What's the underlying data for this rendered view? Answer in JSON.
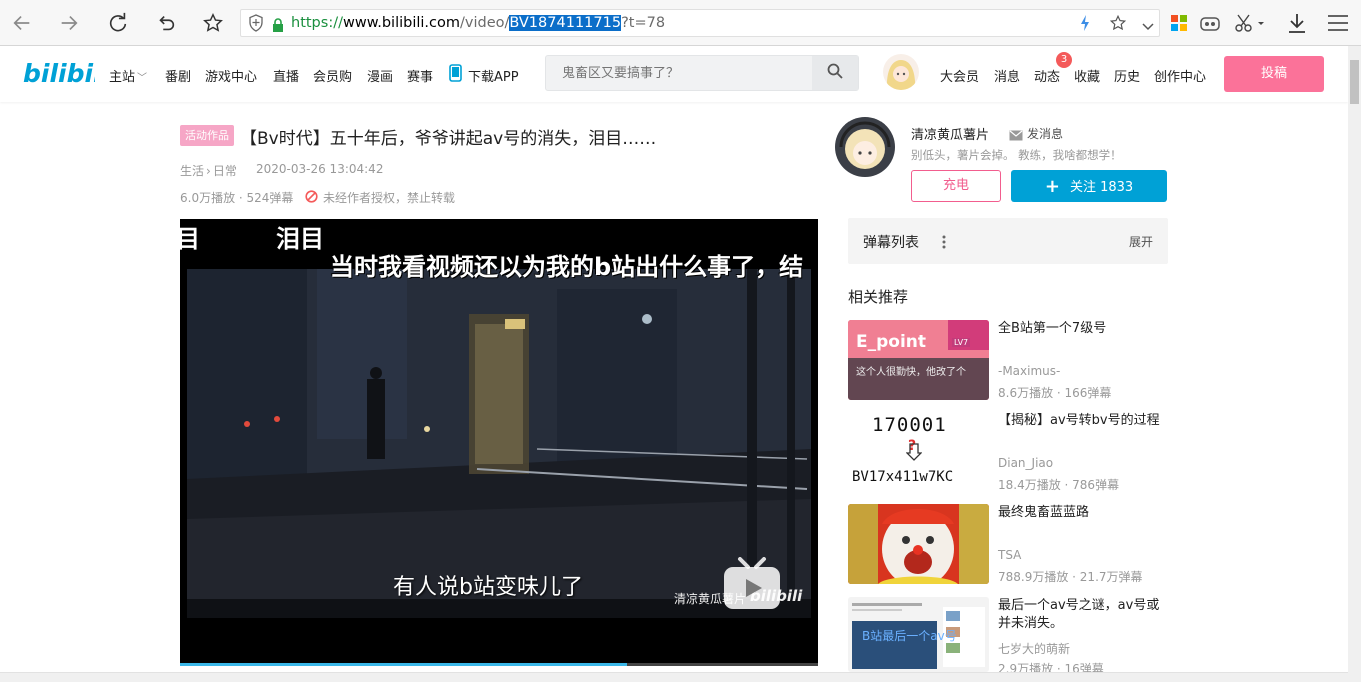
{
  "browser": {
    "url_scheme": "https://",
    "url_host": "www.bilibili.com",
    "url_path": "/video/",
    "url_selected": "BV1874111715",
    "url_query": "?t=78"
  },
  "header": {
    "logo": "bilibili",
    "nav": [
      "主站",
      "番剧",
      "游戏中心",
      "直播",
      "会员购",
      "漫画",
      "赛事",
      "下载APP"
    ],
    "search_placeholder": "鬼畜区又要搞事了？",
    "right_nav": [
      "大会员",
      "消息",
      "动态",
      "收藏",
      "历史",
      "创作中心"
    ],
    "dynamic_badge": "3",
    "upload_label": "投稿"
  },
  "video": {
    "tag": "活动作品",
    "title": "【Bv时代】五十年后，爷爷讲起av号的消失，泪目……",
    "category_main": "生活",
    "category_sub": "日常",
    "date": "2020-03-26 13:04:42",
    "plays": "6.0万播放 · 524弹幕",
    "copyright": "未经作者授权，禁止转载"
  },
  "player": {
    "danmaku_1": "目",
    "danmaku_2": "泪目",
    "danmaku_3": "当时我看视频还以为我的b站出什么事了，结",
    "subtitle": "有人说b站变味儿了",
    "watermark": "清凉黄瓜薯片",
    "watermark_logo": "bilibili",
    "progress": 0.701
  },
  "uploader": {
    "name": "清凉黄瓜薯片",
    "message_label": "发消息",
    "description": "别低头，薯片会掉。 教练，我啥都想学！",
    "charge_label": "充电",
    "follow_label": "关注 1833"
  },
  "danmaku_panel": {
    "title": "弹幕列表",
    "expand_label": "展开"
  },
  "related": {
    "title": "相关推荐",
    "items": [
      {
        "title": "全B站第一个7级号",
        "up": "-Maximus-",
        "stats": "8.6万播放 · 166弹幕",
        "thumb_text": "E_point",
        "thumb_sub": "这个人很勤快，他改了个",
        "thumb_badge": "LV7"
      },
      {
        "title": "【揭秘】av号转bv号的过程",
        "up": "Dian_Jiao",
        "stats": "18.4万播放 · 786弹幕",
        "thumb_top": "170001",
        "thumb_bottom": "BV17x411w7KC",
        "thumb_mark": "?"
      },
      {
        "title": "最终鬼畜蓝蓝路",
        "up": "TSA",
        "stats": "788.9万播放 · 21.7万弹幕"
      },
      {
        "title": "最后一个av号之谜，av号或并未消失。",
        "up": "七岁大的萌新",
        "stats": "2.9万播放 · 16弹幕",
        "thumb_text": "B站最后一个av号"
      }
    ]
  }
}
